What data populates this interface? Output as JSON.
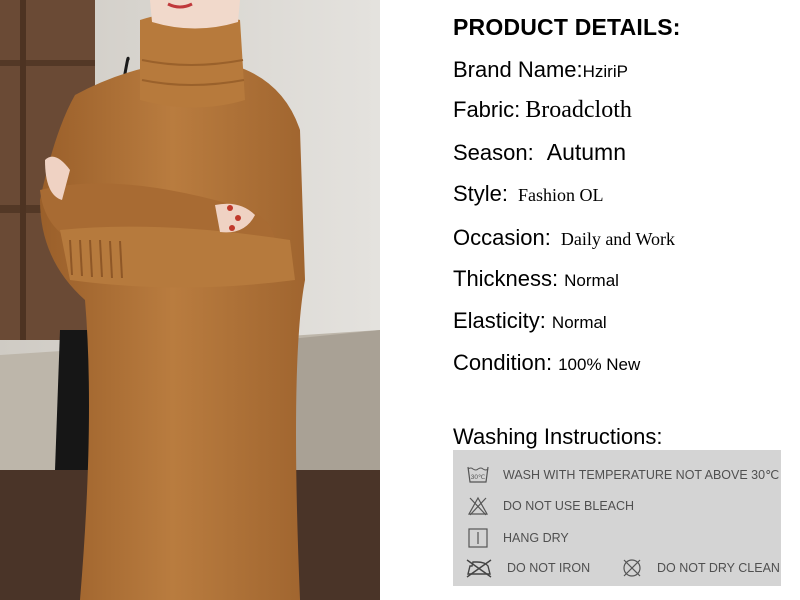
{
  "details": {
    "title": "PRODUCT DETAILS:",
    "rows": [
      {
        "label": "Brand Name:",
        "value": "HziriP"
      },
      {
        "label": "Fabric:",
        "value": "Broadcloth"
      },
      {
        "label": "Season:",
        "value": "Autumn"
      },
      {
        "label": "Style:",
        "value": "Fashion OL"
      },
      {
        "label": "Occasion:",
        "value": "Daily and Work"
      },
      {
        "label": "Thickness:",
        "value": "Normal"
      },
      {
        "label": "Elasticity:",
        "value": "Normal"
      },
      {
        "label": "Condition:",
        "value": "100% New"
      }
    ]
  },
  "washing": {
    "title": "Washing Instructions:",
    "items": [
      {
        "icon": "wash-30-icon",
        "text": "WASH WITH TEMPERATURE NOT ABOVE 30℃",
        "icon_text": "30℃"
      },
      {
        "icon": "no-bleach-icon",
        "text": "DO NOT USE BLEACH"
      },
      {
        "icon": "hang-dry-icon",
        "text": "HANG DRY"
      },
      {
        "icon": "no-iron-icon",
        "text": "DO NOT IRON"
      },
      {
        "icon": "no-dry-clean-icon",
        "text": "DO NOT DRY CLEAN"
      }
    ]
  },
  "colors": {
    "sweater": "#b07438",
    "wash_panel": "#d4d4d4",
    "wash_text": "#505050"
  }
}
